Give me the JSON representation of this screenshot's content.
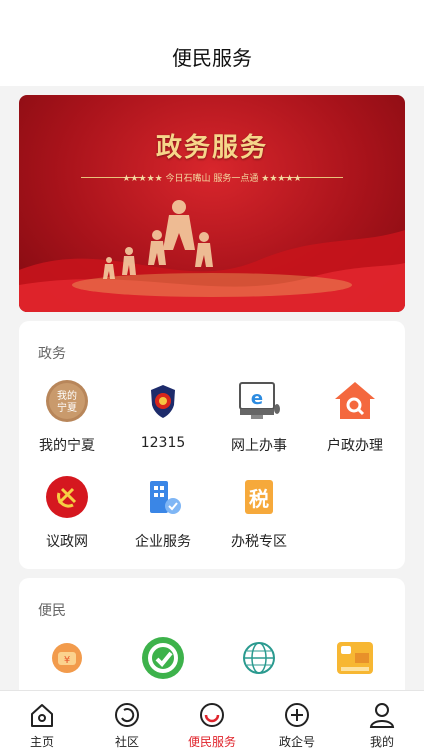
{
  "header": {
    "title": "便民服务"
  },
  "banner": {
    "title": "政务服务",
    "subtitle": "★★★★★  今日石嘴山  服务一点通  ★★★★★"
  },
  "sections": [
    {
      "title": "政务",
      "items": [
        {
          "label": "我的宁夏",
          "icon": "my-ningxia-icon"
        },
        {
          "label": "12315",
          "icon": "market-regulation-badge-icon"
        },
        {
          "label": "网上办事",
          "icon": "computer-icon"
        },
        {
          "label": "户政办理",
          "icon": "house-search-icon"
        },
        {
          "label": "议政网",
          "icon": "party-emblem-icon"
        },
        {
          "label": "企业服务",
          "icon": "enterprise-icon"
        },
        {
          "label": "办税专区",
          "icon": "tax-icon"
        }
      ]
    },
    {
      "title": "便民",
      "items": [
        {
          "label": "",
          "icon": "wallet-orange-icon"
        },
        {
          "label": "",
          "icon": "green-circle-icon"
        },
        {
          "label": "",
          "icon": "globe-logo-icon"
        },
        {
          "label": "",
          "icon": "yellow-card-icon"
        }
      ]
    }
  ],
  "tabs": [
    {
      "label": "主页",
      "icon": "home-icon"
    },
    {
      "label": "社区",
      "icon": "community-icon"
    },
    {
      "label": "便民服务",
      "icon": "smile-icon",
      "active": true
    },
    {
      "label": "政企号",
      "icon": "plus-circle-icon"
    },
    {
      "label": "我的",
      "icon": "user-icon"
    }
  ],
  "colors": {
    "accent": "#e0242c",
    "banner": "#b81820",
    "gold": "#f6d68a"
  }
}
